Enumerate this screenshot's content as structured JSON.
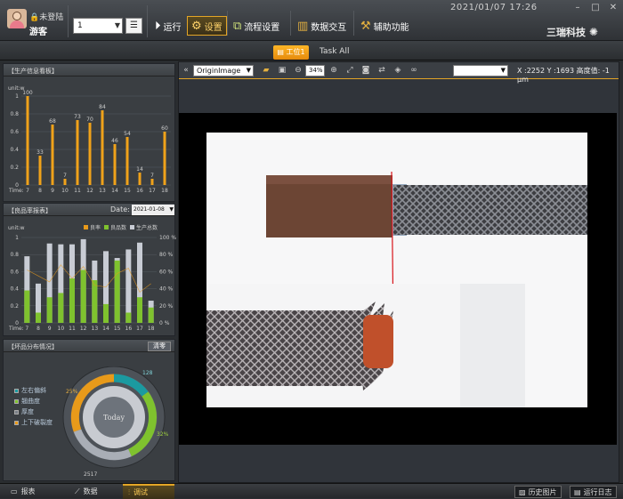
{
  "header": {
    "login_status": "未登陆",
    "user": "游客",
    "station_select": "1",
    "buttons": [
      {
        "label": "运行",
        "icon": "play-icon"
      },
      {
        "label": "设置",
        "icon": "gear-icon"
      },
      {
        "label": "流程设置",
        "icon": "flow-icon"
      },
      {
        "label": "数据交互",
        "icon": "chart-icon"
      },
      {
        "label": "辅助功能",
        "icon": "tools-icon"
      }
    ],
    "datetime": "2021/01/07   17:26",
    "brand": "三瑞科技"
  },
  "tabs": {
    "station": "工位1",
    "task": "Task All"
  },
  "panel_production": {
    "title": "【生产信息看板】",
    "unit": "unit:w",
    "time_label": "Time:"
  },
  "panel_yield": {
    "title": "【良品率报表】",
    "date_label": "Date:",
    "date_value": "2021-01-08",
    "unit": "unit:w",
    "legend": [
      "良率",
      "良品数",
      "生产总数"
    ],
    "time_label": "Time:"
  },
  "panel_defect": {
    "title": "【坏品分布情况】",
    "clear_button": "清零",
    "items": [
      "左右偏斜",
      "翘曲度",
      "厚度",
      "上下破裂度"
    ],
    "center_label": "Today",
    "labels": [
      "128",
      "25%",
      "32%",
      "2517"
    ]
  },
  "viewer": {
    "image_select": "OriginImage",
    "zoom": "34%",
    "coord_readout": "X :2252 Y :1693 高度值: -1 μm",
    "toolbar_icons": [
      "collapse-icon",
      "open-folder-icon",
      "save-icon",
      "zoom-out-icon",
      "zoom-in-icon",
      "fit-icon",
      "camera-icon",
      "swap-icon",
      "cube-icon",
      "link-icon"
    ]
  },
  "bottom": {
    "tabs": [
      "报表",
      "数据",
      "调试"
    ],
    "history_button": "历史图片",
    "log_button": "运行日志"
  },
  "chart_data": [
    {
      "type": "bar",
      "categories": [
        "7",
        "8",
        "9",
        "10",
        "11",
        "12",
        "13",
        "14",
        "15",
        "16",
        "17",
        "18"
      ],
      "values": [
        100,
        33,
        68,
        7,
        73,
        70,
        84,
        46,
        54,
        14,
        7,
        60
      ],
      "ylabel": "unit:w",
      "ylim": [
        0,
        1
      ],
      "yticks": [
        "0",
        "0.2",
        "0.4",
        "0.6",
        "0.8",
        "1"
      ],
      "xlabel": "Time:"
    },
    {
      "type": "bar",
      "categories": [
        "7",
        "8",
        "9",
        "10",
        "11",
        "12",
        "13",
        "14",
        "15",
        "16",
        "17",
        "18"
      ],
      "yticks": [
        "0",
        "0.2",
        "0.4",
        "0.6",
        "0.8",
        "1"
      ],
      "y2ticks": [
        "0 %",
        "20 %",
        "40 %",
        "60 %",
        "80 %",
        "100 %"
      ],
      "series": [
        {
          "name": "良率",
          "values": [
            0.62,
            0.55,
            0.48,
            0.68,
            0.52,
            0.66,
            0.44,
            0.42,
            0.58,
            0.64,
            0.36,
            0.46
          ]
        },
        {
          "name": "良品数",
          "values": [
            0.38,
            0.12,
            0.3,
            0.35,
            0.52,
            0.62,
            0.5,
            0.22,
            0.73,
            0.12,
            0.3,
            0.18
          ]
        },
        {
          "name": "生产总数",
          "values": [
            0.78,
            0.46,
            0.93,
            0.92,
            0.92,
            0.98,
            0.73,
            0.84,
            0.76,
            0.86,
            0.94,
            0.26
          ]
        }
      ],
      "xlabel": "Time:",
      "ylabel": "unit:w"
    }
  ]
}
